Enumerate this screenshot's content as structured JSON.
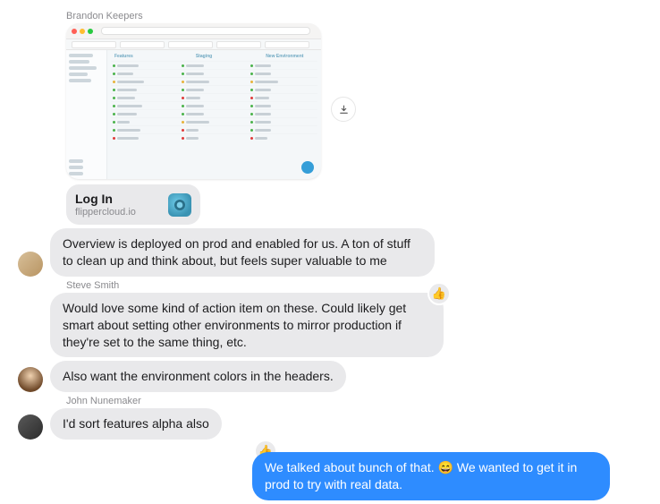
{
  "messages": {
    "m1": {
      "sender": "Brandon Keepers"
    },
    "link_card": {
      "title": "Log In",
      "domain": "flippercloud.io"
    },
    "m2": {
      "text": "Overview is deployed on prod and enabled for us. A ton of stuff to clean up and think about, but feels super valuable to me"
    },
    "m3": {
      "sender": "Steve Smith",
      "text": "Would love some kind of action item on these. Could likely get smart about setting other environments to mirror production if they're set to the same thing, etc."
    },
    "m4": {
      "text": "Also want the environment colors in the headers."
    },
    "m5": {
      "sender": "John Nunemaker",
      "text": "I'd sort features alpha also"
    },
    "m6": {
      "text_a": "We talked about bunch of that. ",
      "emoji": "😄",
      "text_b": " We wanted to get it in prod to try with real data."
    }
  },
  "reactions": {
    "thumbs_up": "👍"
  },
  "screenshot": {
    "tabs": {
      "a": "Features",
      "b": "Staging",
      "c": "New Environment"
    }
  }
}
